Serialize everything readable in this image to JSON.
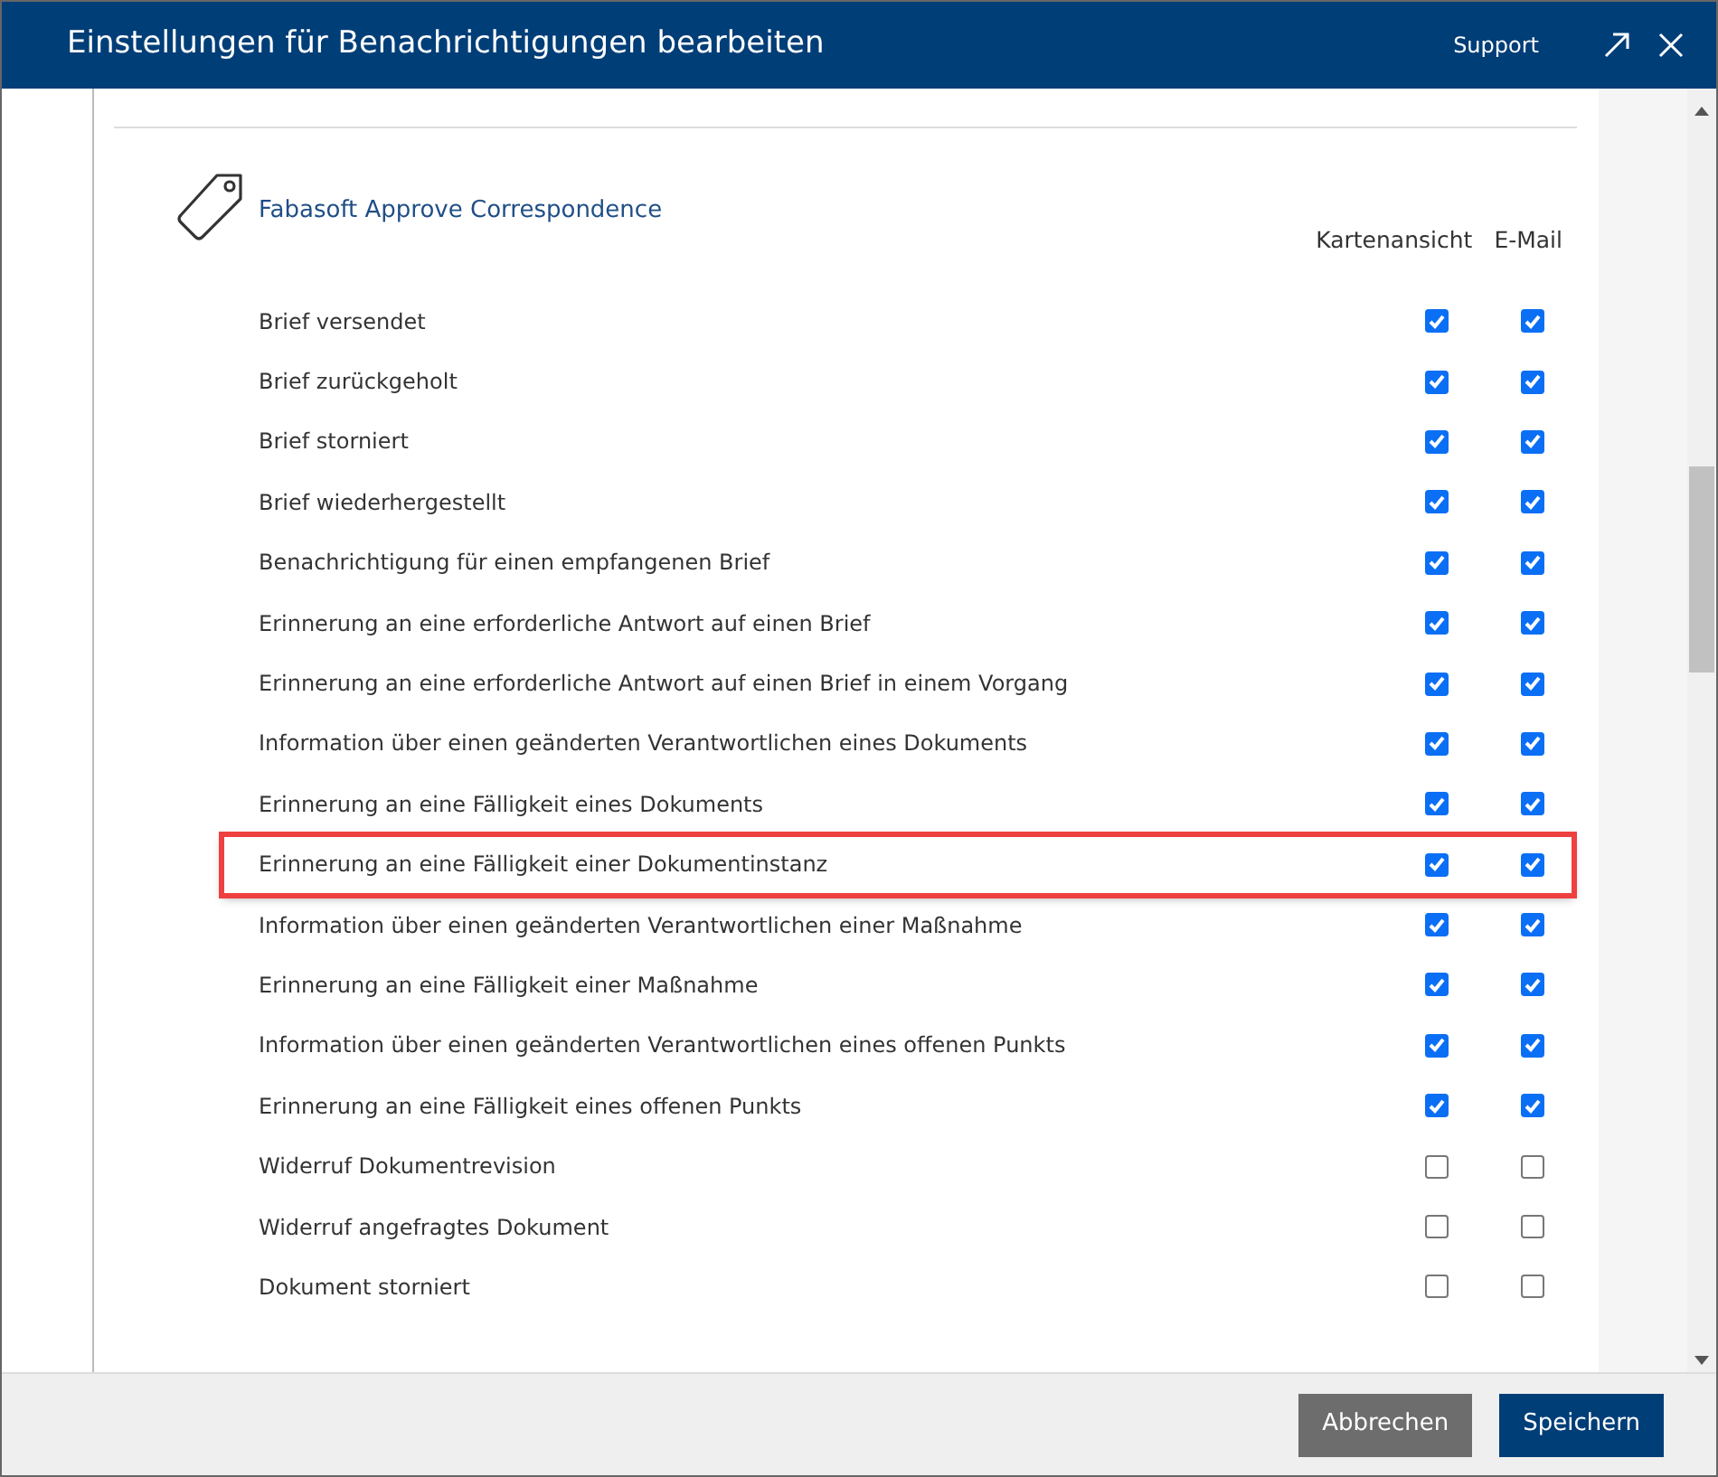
{
  "window": {
    "title": "Einstellungen für Benachrichtigungen bearbeiten",
    "support": "Support"
  },
  "section": {
    "title": "Fabasoft Approve Correspondence",
    "columns": [
      "Kartenansicht",
      "E-Mail"
    ],
    "rows": [
      {
        "label": "Brief versendet",
        "card_view": true,
        "email": true,
        "highlighted": false
      },
      {
        "label": "Brief zurückgeholt",
        "card_view": true,
        "email": true,
        "highlighted": false
      },
      {
        "label": "Brief storniert",
        "card_view": true,
        "email": true,
        "highlighted": false
      },
      {
        "label": "Brief wiederhergestellt",
        "card_view": true,
        "email": true,
        "highlighted": false
      },
      {
        "label": "Benachrichtigung für einen empfangenen Brief",
        "card_view": true,
        "email": true,
        "highlighted": false
      },
      {
        "label": "Erinnerung an eine erforderliche Antwort auf einen Brief",
        "card_view": true,
        "email": true,
        "highlighted": false
      },
      {
        "label": "Erinnerung an eine erforderliche Antwort auf einen Brief in einem Vorgang",
        "card_view": true,
        "email": true,
        "highlighted": false
      },
      {
        "label": "Information über einen geänderten Verantwortlichen eines Dokuments",
        "card_view": true,
        "email": true,
        "highlighted": false
      },
      {
        "label": "Erinnerung an eine Fälligkeit eines Dokuments",
        "card_view": true,
        "email": true,
        "highlighted": false
      },
      {
        "label": "Erinnerung an eine Fälligkeit einer Dokumentinstanz",
        "card_view": true,
        "email": true,
        "highlighted": true
      },
      {
        "label": "Information über einen geänderten Verantwortlichen einer Maßnahme",
        "card_view": true,
        "email": true,
        "highlighted": false
      },
      {
        "label": "Erinnerung an eine Fälligkeit einer Maßnahme",
        "card_view": true,
        "email": true,
        "highlighted": false
      },
      {
        "label": "Information über einen geänderten Verantwortlichen eines offenen Punkts",
        "card_view": true,
        "email": true,
        "highlighted": false
      },
      {
        "label": "Erinnerung an eine Fälligkeit eines offenen Punkts",
        "card_view": true,
        "email": true,
        "highlighted": false
      },
      {
        "label": "Widerruf Dokumentrevision",
        "card_view": false,
        "email": false,
        "highlighted": false
      },
      {
        "label": "Widerruf angefragtes Dokument",
        "card_view": false,
        "email": false,
        "highlighted": false
      },
      {
        "label": "Dokument storniert",
        "card_view": false,
        "email": false,
        "highlighted": false
      }
    ]
  },
  "buttons": [
    {
      "label": "Abbrechen",
      "kind": "secondary"
    },
    {
      "label": "Speichern",
      "kind": "primary"
    }
  ]
}
